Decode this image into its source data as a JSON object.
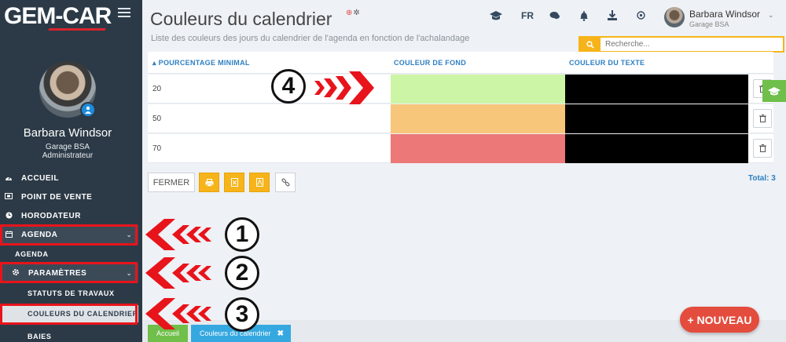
{
  "sidebar": {
    "logo": "GEM-CAR",
    "user_name": "Barbara Windsor",
    "user_org": "Garage BSA",
    "user_role": "Administrateur",
    "items": [
      {
        "label": "ACCUEIL",
        "icon": "tachometer-icon"
      },
      {
        "label": "POINT DE VENTE",
        "icon": "cash-register-icon"
      },
      {
        "label": "HORODATEUR",
        "icon": "clock-icon"
      },
      {
        "label": "AGENDA",
        "icon": "calendar-icon"
      },
      {
        "label": "AGENDA"
      },
      {
        "label": "PARAMÈTRES",
        "icon": "gear-icon"
      },
      {
        "label": "STATUTS DE TRAVAUX"
      },
      {
        "label": "COULEURS DU CALENDRIER"
      },
      {
        "label": "BAIES"
      }
    ]
  },
  "header": {
    "title": "Couleurs du calendrier",
    "subtitle": "Liste des couleurs des jours du calendrier de l'agenda en fonction de l'achalandage",
    "lang": "FR",
    "user_name": "Barbara Windsor",
    "user_org": "Garage BSA"
  },
  "search": {
    "placeholder": "Recherche..."
  },
  "table": {
    "columns": [
      "POURCENTAGE MINIMAL",
      "COULEUR DE FOND",
      "COULEUR DU TEXTE"
    ],
    "rows": [
      {
        "min_pct": "20",
        "bg_color": "#cdf5a6",
        "text_color": "#000000"
      },
      {
        "min_pct": "50",
        "bg_color": "#f7c67a",
        "text_color": "#000000"
      },
      {
        "min_pct": "70",
        "bg_color": "#ec7878",
        "text_color": "#000000"
      }
    ]
  },
  "toolbar": {
    "close_label": "FERMER",
    "total": "Total: 3"
  },
  "footer": {
    "home_tab": "Accueil",
    "current_tab": "Couleurs du calendrier",
    "close_glyph": "✖"
  },
  "new_button": "+ NOUVEAU",
  "callouts": [
    "1",
    "2",
    "3",
    "4"
  ],
  "colors": {
    "sidebar": "#2c3a47",
    "accent_blue": "#2d7fc1",
    "accent_yellow": "#f6b41a",
    "accent_green": "#6fbf4a",
    "highlight_red": "#e8141b"
  }
}
